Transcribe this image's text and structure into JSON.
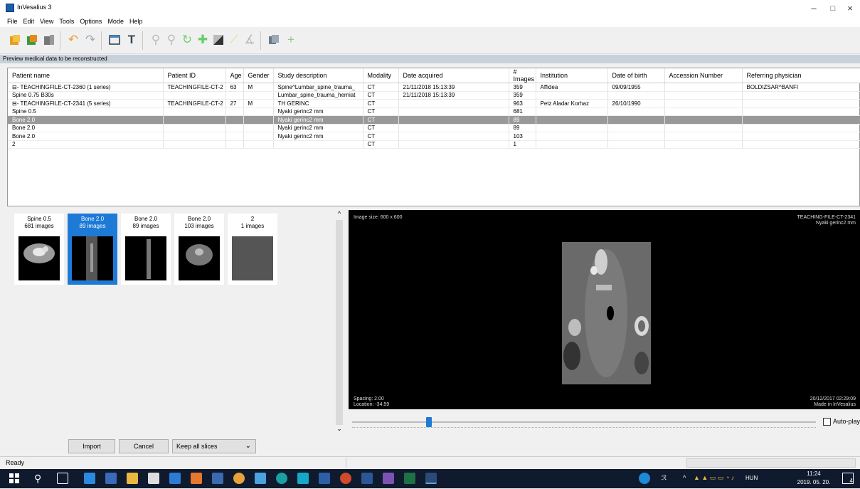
{
  "window": {
    "title": "InVesalius 3",
    "minimize_glyph": "–",
    "maximize_glyph": "□",
    "close_glyph": "×"
  },
  "menu": [
    "File",
    "Edit",
    "View",
    "Tools",
    "Options",
    "Mode",
    "Help"
  ],
  "toolbar": {
    "icons": [
      "import-dicom-icon",
      "import-icon",
      "open-project-icon",
      "undo-icon",
      "redo-icon",
      "window-icon",
      "text-icon",
      "zoom-icon",
      "zoom-select-icon",
      "rotate-icon",
      "pan-icon",
      "contrast-icon",
      "measure-linear-icon",
      "measure-angle-icon",
      "slice-icon",
      "add-icon"
    ]
  },
  "hint": "Preview medical data to be reconstructed",
  "table": {
    "columns": [
      "Patient name",
      "Patient ID",
      "Age",
      "Gender",
      "Study description",
      "Modality",
      "Date acquired",
      "# Images",
      "Institution",
      "Date of birth",
      "Accession Number",
      "Referring physician"
    ],
    "rows": [
      [
        "⊟- TEACHINGFILE-CT-2360 (1 series)",
        "TEACHINGFILE-CT-2",
        "63",
        "M",
        "Spine^Lumbar_spine_trauma_",
        "CT",
        "21/11/2018 15:13:39",
        "359",
        "Affidea",
        "09/09/1955",
        "",
        "BOLDIZSAR^BANFI"
      ],
      [
        "      Spine  0.75  B30s",
        "",
        "",
        "",
        "Lumbar_spine_trauma_herniat",
        "CT",
        "21/11/2018 15:13:39",
        "359",
        "",
        "",
        "",
        ""
      ],
      [
        "⊟- TEACHINGFILE-CT-2341 (5 series)",
        "TEACHINGFILE-CT-2",
        "27",
        "M",
        "TH GERINC",
        "CT",
        "",
        "963",
        "Petz Aladar Korhaz",
        "26/10/1990",
        "",
        ""
      ],
      [
        "      Spine 0.5",
        "",
        "",
        "",
        "Nyaki gerinc2 mm",
        "CT",
        "",
        "681",
        "",
        "",
        "",
        ""
      ],
      [
        "      Bone 2.0",
        "",
        "",
        "",
        "Nyaki gerinc2 mm",
        "CT",
        "",
        "89",
        "",
        "",
        "",
        ""
      ],
      [
        "      Bone 2.0",
        "",
        "",
        "",
        "Nyaki gerinc2 mm",
        "CT",
        "",
        "89",
        "",
        "",
        "",
        ""
      ],
      [
        "      Bone 2.0",
        "",
        "",
        "",
        "Nyaki gerinc2 mm",
        "CT",
        "",
        "103",
        "",
        "",
        "",
        ""
      ],
      [
        "      2",
        "",
        "",
        "",
        "",
        "CT",
        "",
        "1",
        "",
        "",
        "",
        ""
      ]
    ],
    "selected_row": 4
  },
  "thumbnails": [
    {
      "label": "Spine 0.5",
      "count": "681 images"
    },
    {
      "label": "Bone 2.0",
      "count": "89 images"
    },
    {
      "label": "Bone 2.0",
      "count": "89 images"
    },
    {
      "label": "Bone 2.0",
      "count": "103 images"
    },
    {
      "label": "2",
      "count": "1 images"
    }
  ],
  "viewer": {
    "image_size": "Image size: 600 x 600",
    "patient": "TEACHING-FILE-CT-2341",
    "study": "Nyaki gerinc2 mm",
    "spacing": "Spacing: 2.00",
    "location": "Location: -34.59",
    "date": "20/12/2017 02:29:09",
    "made_in": "Made in InVesalius",
    "autoplay_label": "Auto-play"
  },
  "buttons": {
    "import": "Import",
    "cancel": "Cancel",
    "slices_option": "Keep all slices"
  },
  "status": "Ready",
  "taskbar": {
    "language": "HUN",
    "time": "11:24",
    "date": "2019. 05. 20.",
    "notifications": "4"
  }
}
